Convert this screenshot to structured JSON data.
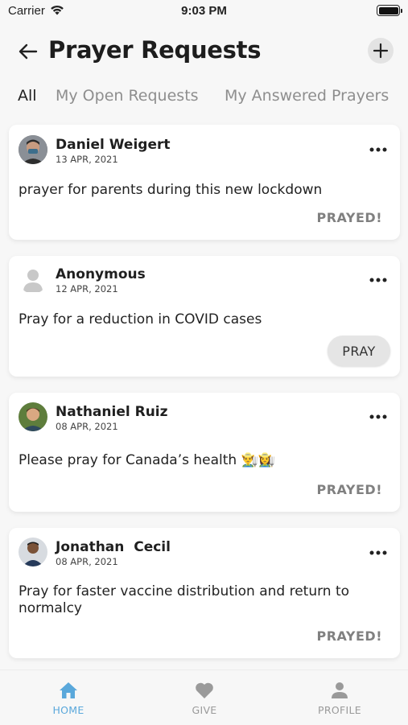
{
  "status_bar": {
    "carrier": "Carrier",
    "time": "9:03 PM"
  },
  "header": {
    "title": "Prayer Requests"
  },
  "tabs": [
    {
      "label": "All",
      "active": true
    },
    {
      "label": "My Open Requests",
      "active": false
    },
    {
      "label": "My Answered Prayers",
      "active": false
    }
  ],
  "requests": [
    {
      "author": "Daniel Weigert",
      "date": "13 APR, 2021",
      "message": "prayer for parents during this new lockdown",
      "action": "PRAYED!"
    },
    {
      "author": "Anonymous",
      "date": "12 APR, 2021",
      "message": "Pray for a reduction in COVID cases",
      "action": "PRAY"
    },
    {
      "author": "Nathaniel Ruiz",
      "date": "08 APR, 2021",
      "message": "Please pray for Canada’s health 👨‍🌾👩‍🌾",
      "action": "PRAYED!"
    },
    {
      "author": "Jonathan  Cecil",
      "date": "08 APR, 2021",
      "message": "Pray for faster vaccine distribution and  return to normalcy",
      "action": "PRAYED!"
    }
  ],
  "tab_bar": [
    {
      "label": "HOME",
      "icon": "home-icon",
      "active": true
    },
    {
      "label": "GIVE",
      "icon": "heart-icon",
      "active": false
    },
    {
      "label": "PROFILE",
      "icon": "person-icon",
      "active": false
    }
  ],
  "colors": {
    "accent": "#5aa8db",
    "inactive": "#9a9a9a"
  }
}
